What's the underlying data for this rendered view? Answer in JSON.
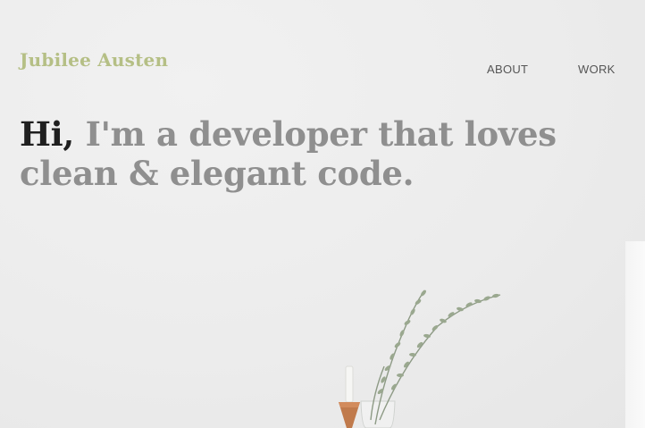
{
  "header": {
    "brand": "Jubilee Austen",
    "nav": [
      {
        "label": "ABOUT"
      },
      {
        "label": "WORK"
      }
    ]
  },
  "hero": {
    "greeting": "Hi,",
    "tagline": " I'm a developer that loves clean & elegant code."
  },
  "colors": {
    "background": "#ececec",
    "brand": "#b5bf85",
    "headline": "#8f8f8f",
    "greeting": "#1f1f1f",
    "nav_text": "#555555"
  }
}
